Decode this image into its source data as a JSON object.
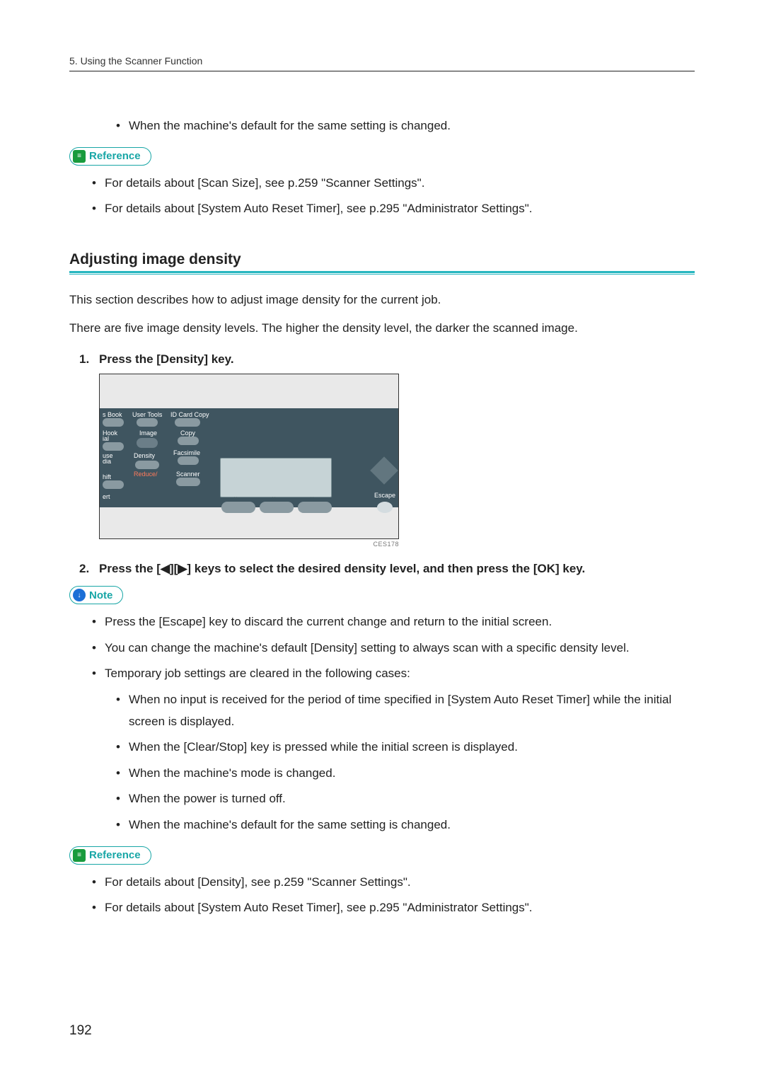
{
  "header": {
    "running": "5. Using the Scanner Function"
  },
  "intro_bullet": "When the machine's default for the same setting is changed.",
  "callout": {
    "reference": "Reference",
    "note": "Note"
  },
  "ref1": {
    "items": [
      "For details about [Scan Size], see p.259 \"Scanner Settings\".",
      "For details about [System Auto Reset Timer], see p.295 \"Administrator Settings\"."
    ]
  },
  "section": {
    "title": "Adjusting image density",
    "p1": "This section describes how to adjust image density for the current job.",
    "p2": "There are five image density levels. The higher the density level, the darker the scanned image."
  },
  "steps": {
    "s1": {
      "num": "1.",
      "text": "Press the [Density] key."
    },
    "s2": {
      "num": "2.",
      "text_pre": "Press the [",
      "text_mid": "][",
      "text_post": "] keys to select the desired density level, and then press the [OK] key."
    }
  },
  "figure": {
    "labels": {
      "book": "s Book",
      "usertools": "User Tools",
      "idcard": "ID Card Copy",
      "hook": "Hook",
      "ial": "ial",
      "image": "Image",
      "copy": "Copy",
      "use": "use",
      "dia": "dia",
      "density": "Density",
      "facsimile": "Facsimile",
      "hift": "hift",
      "reduce": "Reduce/",
      "scanner": "Scanner",
      "ert": "ert",
      "escape": "Escape"
    },
    "code": "CES178"
  },
  "notes": {
    "items": [
      "Press the [Escape] key to discard the current change and return to the initial screen.",
      "You can change the machine's default [Density] setting to always scan with a specific density level.",
      "Temporary job settings are cleared in the following cases:"
    ],
    "sub": [
      "When no input is received for the period of time specified in [System Auto Reset Timer] while the initial screen is displayed.",
      "When the [Clear/Stop] key is pressed while the initial screen is displayed.",
      "When the machine's mode is changed.",
      "When the power is turned off.",
      "When the machine's default for the same setting is changed."
    ]
  },
  "ref2": {
    "items": [
      "For details about [Density], see p.259 \"Scanner Settings\".",
      "For details about [System Auto Reset Timer], see p.295 \"Administrator Settings\"."
    ]
  },
  "pagenum": "192"
}
